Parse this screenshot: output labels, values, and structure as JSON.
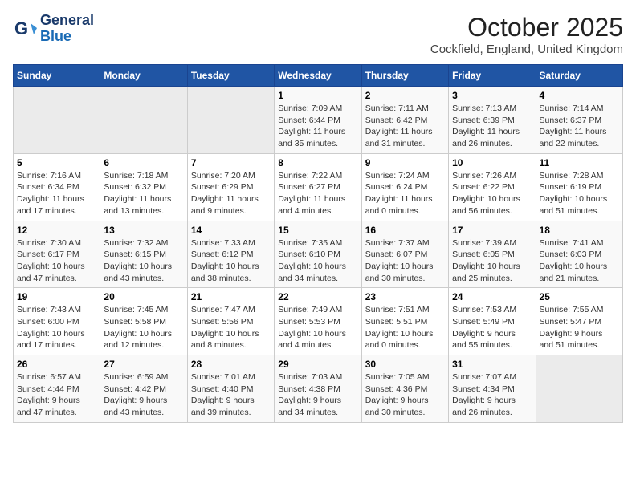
{
  "header": {
    "logo_line1": "General",
    "logo_line2": "Blue",
    "month": "October 2025",
    "location": "Cockfield, England, United Kingdom"
  },
  "weekdays": [
    "Sunday",
    "Monday",
    "Tuesday",
    "Wednesday",
    "Thursday",
    "Friday",
    "Saturday"
  ],
  "weeks": [
    [
      {
        "day": "",
        "info": ""
      },
      {
        "day": "",
        "info": ""
      },
      {
        "day": "",
        "info": ""
      },
      {
        "day": "1",
        "info": "Sunrise: 7:09 AM\nSunset: 6:44 PM\nDaylight: 11 hours\nand 35 minutes."
      },
      {
        "day": "2",
        "info": "Sunrise: 7:11 AM\nSunset: 6:42 PM\nDaylight: 11 hours\nand 31 minutes."
      },
      {
        "day": "3",
        "info": "Sunrise: 7:13 AM\nSunset: 6:39 PM\nDaylight: 11 hours\nand 26 minutes."
      },
      {
        "day": "4",
        "info": "Sunrise: 7:14 AM\nSunset: 6:37 PM\nDaylight: 11 hours\nand 22 minutes."
      }
    ],
    [
      {
        "day": "5",
        "info": "Sunrise: 7:16 AM\nSunset: 6:34 PM\nDaylight: 11 hours\nand 17 minutes."
      },
      {
        "day": "6",
        "info": "Sunrise: 7:18 AM\nSunset: 6:32 PM\nDaylight: 11 hours\nand 13 minutes."
      },
      {
        "day": "7",
        "info": "Sunrise: 7:20 AM\nSunset: 6:29 PM\nDaylight: 11 hours\nand 9 minutes."
      },
      {
        "day": "8",
        "info": "Sunrise: 7:22 AM\nSunset: 6:27 PM\nDaylight: 11 hours\nand 4 minutes."
      },
      {
        "day": "9",
        "info": "Sunrise: 7:24 AM\nSunset: 6:24 PM\nDaylight: 11 hours\nand 0 minutes."
      },
      {
        "day": "10",
        "info": "Sunrise: 7:26 AM\nSunset: 6:22 PM\nDaylight: 10 hours\nand 56 minutes."
      },
      {
        "day": "11",
        "info": "Sunrise: 7:28 AM\nSunset: 6:19 PM\nDaylight: 10 hours\nand 51 minutes."
      }
    ],
    [
      {
        "day": "12",
        "info": "Sunrise: 7:30 AM\nSunset: 6:17 PM\nDaylight: 10 hours\nand 47 minutes."
      },
      {
        "day": "13",
        "info": "Sunrise: 7:32 AM\nSunset: 6:15 PM\nDaylight: 10 hours\nand 43 minutes."
      },
      {
        "day": "14",
        "info": "Sunrise: 7:33 AM\nSunset: 6:12 PM\nDaylight: 10 hours\nand 38 minutes."
      },
      {
        "day": "15",
        "info": "Sunrise: 7:35 AM\nSunset: 6:10 PM\nDaylight: 10 hours\nand 34 minutes."
      },
      {
        "day": "16",
        "info": "Sunrise: 7:37 AM\nSunset: 6:07 PM\nDaylight: 10 hours\nand 30 minutes."
      },
      {
        "day": "17",
        "info": "Sunrise: 7:39 AM\nSunset: 6:05 PM\nDaylight: 10 hours\nand 25 minutes."
      },
      {
        "day": "18",
        "info": "Sunrise: 7:41 AM\nSunset: 6:03 PM\nDaylight: 10 hours\nand 21 minutes."
      }
    ],
    [
      {
        "day": "19",
        "info": "Sunrise: 7:43 AM\nSunset: 6:00 PM\nDaylight: 10 hours\nand 17 minutes."
      },
      {
        "day": "20",
        "info": "Sunrise: 7:45 AM\nSunset: 5:58 PM\nDaylight: 10 hours\nand 12 minutes."
      },
      {
        "day": "21",
        "info": "Sunrise: 7:47 AM\nSunset: 5:56 PM\nDaylight: 10 hours\nand 8 minutes."
      },
      {
        "day": "22",
        "info": "Sunrise: 7:49 AM\nSunset: 5:53 PM\nDaylight: 10 hours\nand 4 minutes."
      },
      {
        "day": "23",
        "info": "Sunrise: 7:51 AM\nSunset: 5:51 PM\nDaylight: 10 hours\nand 0 minutes."
      },
      {
        "day": "24",
        "info": "Sunrise: 7:53 AM\nSunset: 5:49 PM\nDaylight: 9 hours\nand 55 minutes."
      },
      {
        "day": "25",
        "info": "Sunrise: 7:55 AM\nSunset: 5:47 PM\nDaylight: 9 hours\nand 51 minutes."
      }
    ],
    [
      {
        "day": "26",
        "info": "Sunrise: 6:57 AM\nSunset: 4:44 PM\nDaylight: 9 hours\nand 47 minutes."
      },
      {
        "day": "27",
        "info": "Sunrise: 6:59 AM\nSunset: 4:42 PM\nDaylight: 9 hours\nand 43 minutes."
      },
      {
        "day": "28",
        "info": "Sunrise: 7:01 AM\nSunset: 4:40 PM\nDaylight: 9 hours\nand 39 minutes."
      },
      {
        "day": "29",
        "info": "Sunrise: 7:03 AM\nSunset: 4:38 PM\nDaylight: 9 hours\nand 34 minutes."
      },
      {
        "day": "30",
        "info": "Sunrise: 7:05 AM\nSunset: 4:36 PM\nDaylight: 9 hours\nand 30 minutes."
      },
      {
        "day": "31",
        "info": "Sunrise: 7:07 AM\nSunset: 4:34 PM\nDaylight: 9 hours\nand 26 minutes."
      },
      {
        "day": "",
        "info": ""
      }
    ]
  ]
}
